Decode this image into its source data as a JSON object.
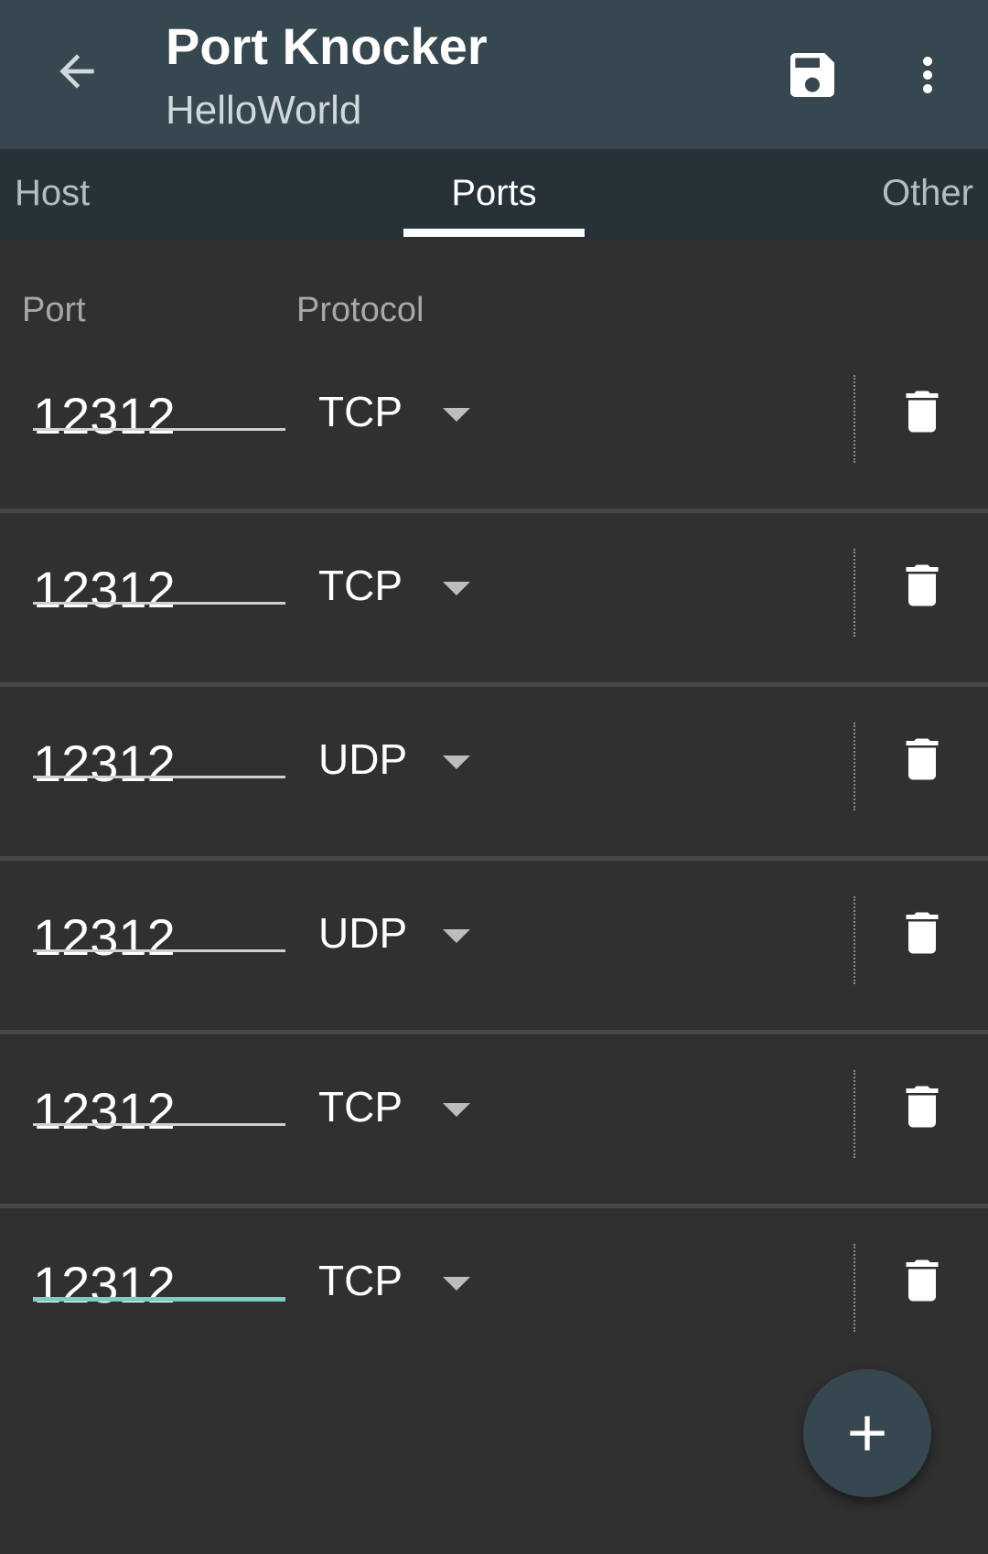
{
  "appbar": {
    "title": "Port Knocker",
    "subtitle": "HelloWorld",
    "back_icon": "arrow-back-icon",
    "save_icon": "save-icon",
    "menu_icon": "more-vert-icon",
    "background": "#37474f"
  },
  "tabs": [
    {
      "label": "Host",
      "active": false
    },
    {
      "label": "Ports",
      "active": true
    },
    {
      "label": "Other",
      "active": false
    }
  ],
  "columns": {
    "port": "Port",
    "protocol": "Protocol"
  },
  "rows": [
    {
      "port": "12312",
      "protocol": "TCP",
      "focused": false
    },
    {
      "port": "12312",
      "protocol": "TCP",
      "focused": false
    },
    {
      "port": "12312",
      "protocol": "UDP",
      "focused": false
    },
    {
      "port": "12312",
      "protocol": "UDP",
      "focused": false
    },
    {
      "port": "12312",
      "protocol": "TCP",
      "focused": false
    },
    {
      "port": "12312",
      "protocol": "TCP",
      "focused": true
    }
  ],
  "row_delete_icon": "delete-icon",
  "fab": {
    "icon": "add-icon"
  },
  "colors": {
    "background": "#303030",
    "tabbar": "#263238",
    "focus_accent": "#80cbc4"
  }
}
